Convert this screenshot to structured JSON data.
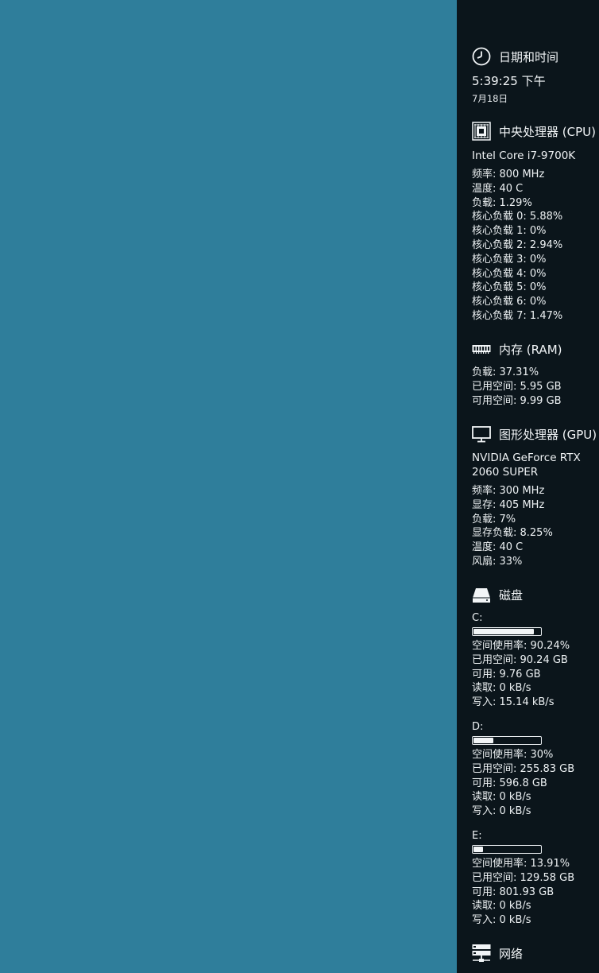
{
  "datetime": {
    "title": "日期和时间",
    "icon": "clock-icon",
    "time": "5:39:25 下午",
    "date": "7月18日"
  },
  "cpu": {
    "title": "中央处理器 (CPU)",
    "icon": "cpu-chip-icon",
    "model": "Intel Core i7-9700K",
    "lines": [
      "频率: 800 MHz",
      "温度: 40 C",
      "负载: 1.29%",
      "核心负载 0: 5.88%",
      "核心负载 1: 0%",
      "核心负载 2: 2.94%",
      "核心负载 3: 0%",
      "核心负载 4: 0%",
      "核心负载 5: 0%",
      "核心负载 6: 0%",
      "核心负载 7: 1.47%"
    ]
  },
  "ram": {
    "title": "内存 (RAM)",
    "icon": "memory-module-icon",
    "lines": [
      "负载: 37.31%",
      "已用空间: 5.95 GB",
      "可用空间: 9.99 GB"
    ]
  },
  "gpu": {
    "title": "图形处理器 (GPU)",
    "icon": "monitor-icon",
    "model": "NVIDIA GeForce RTX 2060 SUPER",
    "lines": [
      "频率: 300 MHz",
      "显存: 405 MHz",
      "负载: 7%",
      "显存负载: 8.25%",
      "温度: 40 C",
      "风扇: 33%"
    ]
  },
  "disk": {
    "title": "磁盘",
    "icon": "hard-drive-icon",
    "drives": [
      {
        "label": "C:",
        "usage_fraction": 0.9024,
        "lines": [
          "空间使用率: 90.24%",
          "已用空间: 90.24 GB",
          "可用: 9.76 GB",
          "读取: 0 kB/s",
          "写入: 15.14 kB/s"
        ]
      },
      {
        "label": "D:",
        "usage_fraction": 0.3,
        "lines": [
          "空间使用率: 30%",
          "已用空间: 255.83 GB",
          "可用: 596.8 GB",
          "读取: 0 kB/s",
          "写入: 0 kB/s"
        ]
      },
      {
        "label": "E:",
        "usage_fraction": 0.1391,
        "lines": [
          "空间使用率: 13.91%",
          "已用空间: 129.58 GB",
          "可用: 801.93 GB",
          "读取: 0 kB/s",
          "写入: 0 kB/s"
        ]
      }
    ]
  },
  "network": {
    "title": "网络",
    "icon": "network-server-icon"
  },
  "colors": {
    "desktop": "#2f7e9b",
    "sidebar": "#0b151b",
    "text": "#eef2f4"
  }
}
